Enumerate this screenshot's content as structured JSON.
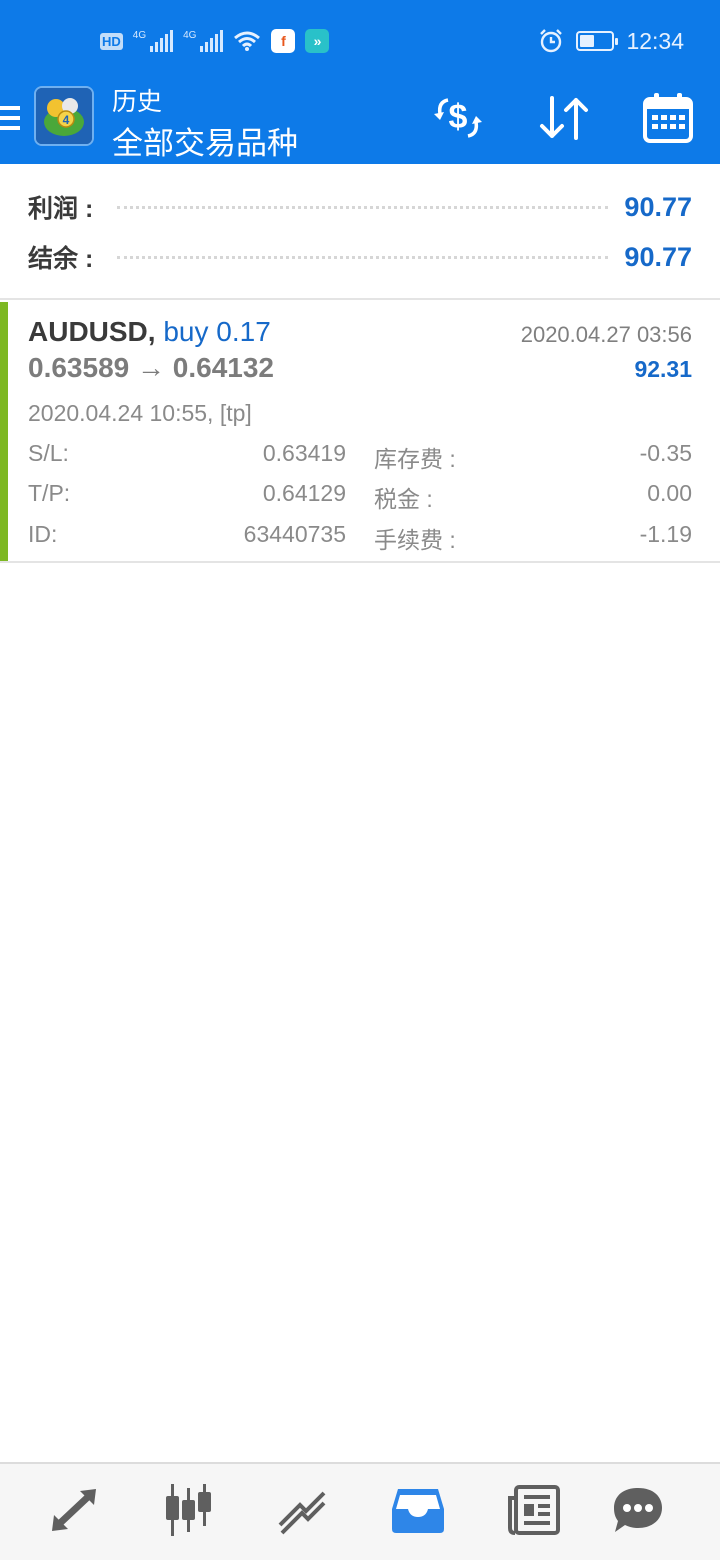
{
  "status_bar": {
    "hd": "HD",
    "sim1": "4G",
    "sim2": "4G",
    "time": "12:34",
    "battery_level": 0.45
  },
  "app_bar": {
    "title": "历史",
    "subtitle": "全部交易品种",
    "accent": "#0d7ae8"
  },
  "summary": {
    "profit_label": "利润 :",
    "profit_value": "90.77",
    "balance_label": "结余 :",
    "balance_value": "90.77"
  },
  "trade": {
    "symbol": "AUDUSD,",
    "type": "buy 0.17",
    "close_time": "2020.04.27 03:56",
    "prices": "0.63589 → 0.64132",
    "profit": "92.31",
    "open_info": "2020.04.24 10:55, [tp]",
    "rows": [
      {
        "label": "S/L:",
        "value": "0.63419",
        "label2": "库存费 :",
        "value2": "-0.35"
      },
      {
        "label": "T/P:",
        "value": "0.64129",
        "label2": "税金 :",
        "value2": "0.00"
      },
      {
        "label": "ID:",
        "value": "63440735",
        "label2": "手续费 :",
        "value2": "-1.19"
      }
    ],
    "indicator_color": "#7db823"
  },
  "nav": {
    "items": [
      "quotes-icon",
      "chart-icon",
      "trade-icon",
      "history-icon",
      "news-icon",
      "chat-icon"
    ],
    "active": "history-icon",
    "active_color": "#2e86e8"
  }
}
